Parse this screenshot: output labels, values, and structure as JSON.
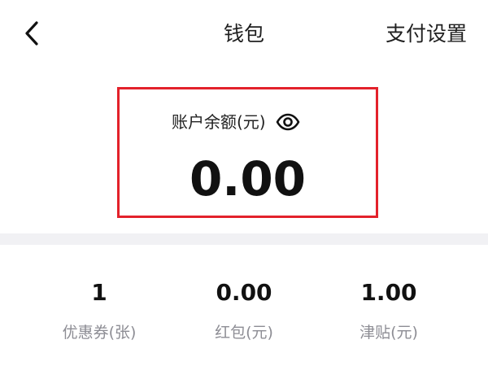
{
  "header": {
    "back_icon": "chevron-left-icon",
    "title": "钱包",
    "settings_label": "支付设置"
  },
  "balance": {
    "label": "账户余额(元)",
    "visibility_icon": "eye-icon",
    "amount": "0.00",
    "highlight_color": "#e3212b"
  },
  "stats": {
    "items": [
      {
        "value": "1",
        "label": "优惠券(张)"
      },
      {
        "value": "0.00",
        "label": "红包(元)"
      },
      {
        "value": "1.00",
        "label": "津贴(元)"
      }
    ]
  }
}
